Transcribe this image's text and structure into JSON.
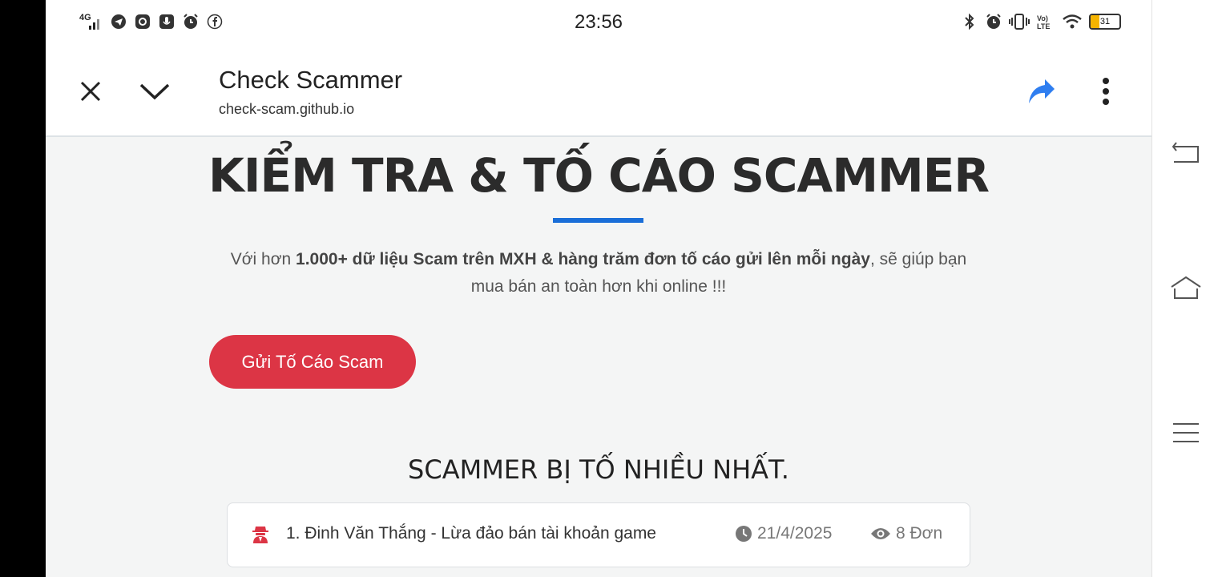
{
  "status_bar": {
    "time": "23:56",
    "network": "4G",
    "volte": "VoLTE",
    "battery": "31",
    "battery_level": 0.31,
    "left_icons": [
      "signal-icon",
      "telegram-icon",
      "instagram-icon",
      "voice-recorder-icon",
      "alarm-icon",
      "facebook-icon"
    ],
    "right_icons": [
      "bluetooth-icon",
      "alarm-icon",
      "vibrate-icon",
      "volte-icon",
      "wifi-icon",
      "battery-icon"
    ]
  },
  "tab_bar": {
    "title": "Check Scammer",
    "url": "check-scam.github.io",
    "icons": [
      "close-icon",
      "chevron-down-icon",
      "share-icon",
      "more-vert-icon"
    ]
  },
  "hero": {
    "title": "KIỂM TRA & TỐ CÁO SCAMMER",
    "desc_prefix": "Với hơn ",
    "desc_bold": "1.000+ dữ liệu Scam trên MXH & hàng trăm đơn tố cáo gửi lên mỗi ngày",
    "desc_suffix": ", sẽ giúp bạn mua bán an toàn hơn khi online !!!",
    "report_button": "Gửi Tố Cáo Scam"
  },
  "top_scammers": {
    "title": "SCAMMER BỊ TỐ NHIỀU NHẤT.",
    "items": [
      {
        "name": "1. Đinh Văn Thắng - Lừa đảo bán tài khoản game",
        "date": "21/4/2025",
        "count": "8 Đơn"
      }
    ]
  },
  "colors": {
    "accent_blue": "#1a6ed8",
    "report_red": "#dc3545",
    "share_blue": "#2f7ef0",
    "page_bg": "#f4f5f5"
  },
  "nav_bar": {
    "icons": [
      "back-icon",
      "home-icon",
      "recents-icon"
    ]
  }
}
